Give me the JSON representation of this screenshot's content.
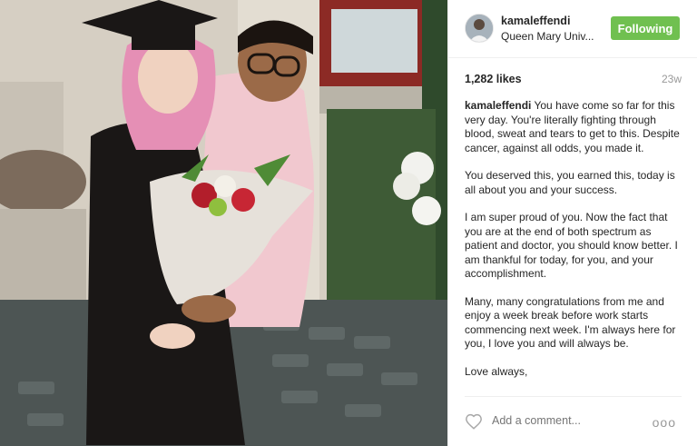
{
  "post": {
    "username": "kamaleffendi",
    "location": "Queen Mary Univ...",
    "follow_label": "Following",
    "likes": "1,282 likes",
    "age": "23w",
    "caption": {
      "username": "kamaleffendi",
      "p1": "You have come so far for this very day. You're literally fighting through blood, sweat and tears to get to this. Despite cancer, against all odds, you made it.",
      "p2": "You deserved this, you earned this, today is all about you and your success.",
      "p3": "I am super proud of you. Now the fact that you are at the end of both spectrum as patient and doctor, you should know better. I am thankful for today, for you, and your accomplishment.",
      "p4": "Many, many congratulations from me and enjoy a week break before work starts commencing next week. I'm always here for you, I love you and will always be.",
      "p5": "Love always,"
    },
    "comment_placeholder": "Add a comment...",
    "more_label": "ooo",
    "icons": {
      "like": "heart-icon",
      "more": "more-options-icon"
    },
    "colors": {
      "follow_bg": "#70c050",
      "muted": "#999999",
      "text": "#262626"
    }
  }
}
